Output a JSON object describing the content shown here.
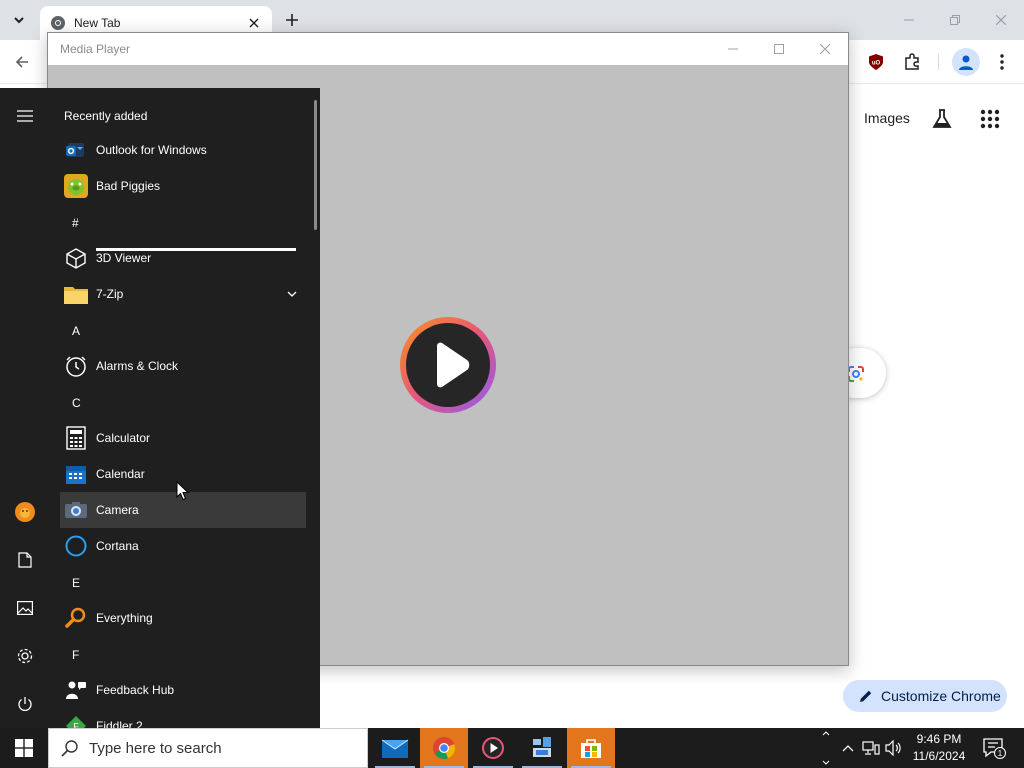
{
  "chrome": {
    "tab_title": "New Tab",
    "images_link": "Images",
    "customize_label": "Customize Chrome",
    "profile_color": "#d3e3fd"
  },
  "media_player": {
    "title": "Media Player",
    "background": "#c0c0c0"
  },
  "start_menu": {
    "header": "Recently added",
    "letters": [
      "#",
      "A",
      "C",
      "E",
      "F"
    ],
    "apps": [
      {
        "label": "Outlook for Windows",
        "icon": "outlook-icon"
      },
      {
        "label": "Bad Piggies",
        "icon": "bad-piggies-icon"
      },
      {
        "label": "3D Viewer",
        "icon": "cube-icon"
      },
      {
        "label": "7-Zip",
        "icon": "folder-icon"
      },
      {
        "label": "Alarms & Clock",
        "icon": "clock-icon"
      },
      {
        "label": "Calculator",
        "icon": "calculator-icon"
      },
      {
        "label": "Calendar",
        "icon": "calendar-icon"
      },
      {
        "label": "Camera",
        "icon": "camera-icon"
      },
      {
        "label": "Cortana",
        "icon": "cortana-icon"
      },
      {
        "label": "Everything",
        "icon": "search-magnifier-icon"
      },
      {
        "label": "Feedback Hub",
        "icon": "feedback-icon"
      },
      {
        "label": "Fiddler 2",
        "icon": "fiddler-icon"
      }
    ]
  },
  "taskbar": {
    "search_placeholder": "Type here to search",
    "time": "9:46 PM",
    "date": "11/6/2024",
    "notification_count": "1",
    "accent": "#e3751c"
  }
}
